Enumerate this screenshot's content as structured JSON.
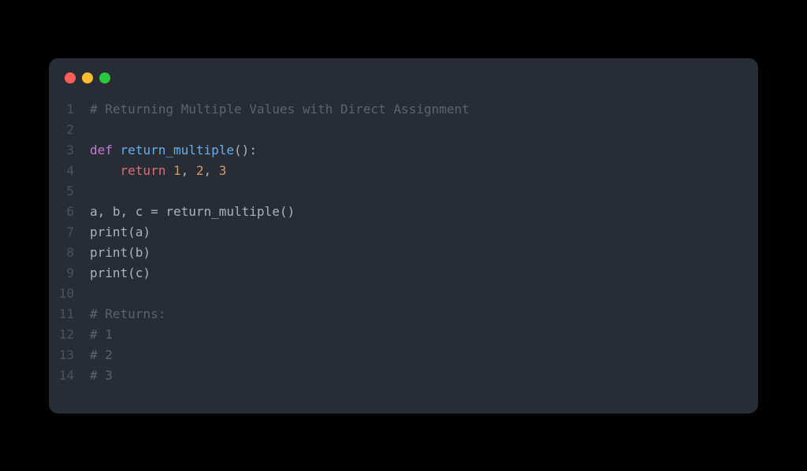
{
  "traffic_lights": [
    "red",
    "yellow",
    "green"
  ],
  "code": {
    "lines": [
      {
        "num": 1,
        "tokens": [
          {
            "cls": "tok-comment",
            "t": "# Returning Multiple Values with Direct Assignment"
          }
        ]
      },
      {
        "num": 2,
        "tokens": [
          {
            "cls": "tok-plain",
            "t": ""
          }
        ]
      },
      {
        "num": 3,
        "tokens": [
          {
            "cls": "tok-keyword",
            "t": "def"
          },
          {
            "cls": "tok-plain",
            "t": " "
          },
          {
            "cls": "tok-funcname",
            "t": "return_multiple"
          },
          {
            "cls": "tok-plain",
            "t": "():"
          }
        ]
      },
      {
        "num": 4,
        "tokens": [
          {
            "cls": "tok-plain",
            "t": "    "
          },
          {
            "cls": "tok-return",
            "t": "return"
          },
          {
            "cls": "tok-plain",
            "t": " "
          },
          {
            "cls": "tok-number",
            "t": "1"
          },
          {
            "cls": "tok-plain",
            "t": ", "
          },
          {
            "cls": "tok-number",
            "t": "2"
          },
          {
            "cls": "tok-plain",
            "t": ", "
          },
          {
            "cls": "tok-number",
            "t": "3"
          }
        ]
      },
      {
        "num": 5,
        "tokens": [
          {
            "cls": "tok-plain",
            "t": ""
          }
        ]
      },
      {
        "num": 6,
        "tokens": [
          {
            "cls": "tok-plain",
            "t": "a, b, c = return_multiple()"
          }
        ]
      },
      {
        "num": 7,
        "tokens": [
          {
            "cls": "tok-plain",
            "t": "print(a)"
          }
        ]
      },
      {
        "num": 8,
        "tokens": [
          {
            "cls": "tok-plain",
            "t": "print(b)"
          }
        ]
      },
      {
        "num": 9,
        "tokens": [
          {
            "cls": "tok-plain",
            "t": "print(c)"
          }
        ]
      },
      {
        "num": 10,
        "tokens": [
          {
            "cls": "tok-plain",
            "t": ""
          }
        ]
      },
      {
        "num": 11,
        "tokens": [
          {
            "cls": "tok-comment",
            "t": "# Returns:"
          }
        ]
      },
      {
        "num": 12,
        "tokens": [
          {
            "cls": "tok-comment",
            "t": "# 1"
          }
        ]
      },
      {
        "num": 13,
        "tokens": [
          {
            "cls": "tok-comment",
            "t": "# 2"
          }
        ]
      },
      {
        "num": 14,
        "tokens": [
          {
            "cls": "tok-comment",
            "t": "# 3"
          }
        ]
      }
    ]
  }
}
